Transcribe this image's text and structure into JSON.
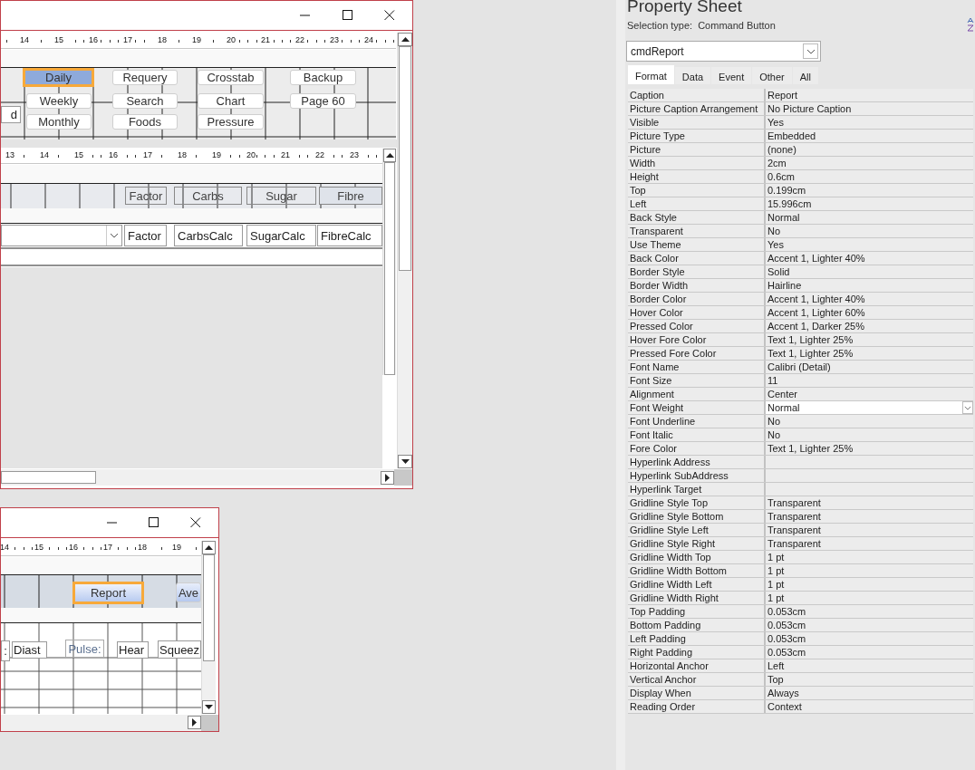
{
  "windows": [
    {
      "ruler": [
        "14",
        "15",
        "16",
        "17",
        "18",
        "19",
        "20",
        "21",
        "22",
        "23",
        "24"
      ],
      "controls": [
        {
          "kind": "textbox",
          "text": "d",
          "selected": false
        },
        {
          "kind": "button",
          "text": "Daily",
          "selected": true
        },
        {
          "kind": "button",
          "text": "Weekly",
          "selected": false
        },
        {
          "kind": "button",
          "text": "Monthly",
          "selected": false
        },
        {
          "kind": "button",
          "text": "Requery",
          "selected": false
        },
        {
          "kind": "button",
          "text": "Search",
          "selected": false
        },
        {
          "kind": "button",
          "text": "Foods",
          "selected": false
        },
        {
          "kind": "button",
          "text": "Crosstab",
          "selected": false
        },
        {
          "kind": "button",
          "text": "Chart",
          "selected": false
        },
        {
          "kind": "button",
          "text": "Pressure",
          "selected": false
        },
        {
          "kind": "button",
          "text": "Backup",
          "selected": false
        },
        {
          "kind": "button",
          "text": "Page 60",
          "selected": false
        }
      ],
      "subform": {
        "ruler": [
          "13",
          "14",
          "15",
          "16",
          "17",
          "18",
          "19",
          "20",
          "21",
          "22",
          "23"
        ],
        "controls": [
          {
            "kind": "label",
            "text": "Factor",
            "selected": false
          },
          {
            "kind": "label",
            "text": "Carbs",
            "selected": false
          },
          {
            "kind": "label",
            "text": "Sugar",
            "selected": false
          },
          {
            "kind": "label",
            "text": "Fibre",
            "selected": false
          },
          {
            "kind": "combo",
            "selected": false
          },
          {
            "kind": "textbox",
            "text": "Factor",
            "selected": false
          },
          {
            "kind": "textbox",
            "text": "CarbsCalc",
            "selected": false
          },
          {
            "kind": "textbox",
            "text": "SugarCalc",
            "selected": false
          },
          {
            "kind": "textbox",
            "text": "FibreCalc",
            "selected": false
          }
        ]
      }
    },
    {
      "ruler": [
        "14",
        "15",
        "16",
        "17",
        "18",
        "19"
      ],
      "controls": [
        {
          "kind": "button",
          "text": "Report",
          "selected": true
        },
        {
          "kind": "button",
          "text": "Ave",
          "selected": false
        },
        {
          "kind": "textbox",
          "text": ":",
          "selected": false
        },
        {
          "kind": "textbox",
          "text": "Diast",
          "selected": false
        },
        {
          "kind": "label",
          "text": "Pulse:",
          "selected": false
        },
        {
          "kind": "textbox",
          "text": "Hear",
          "selected": false
        },
        {
          "kind": "textbox",
          "text": "Squeez",
          "selected": false
        }
      ]
    }
  ],
  "property_sheet": {
    "title": "Property Sheet",
    "selection_type_label": "Selection type:",
    "selection_type": "Command Button",
    "object": "cmdReport",
    "tabs": [
      {
        "label": "Format",
        "selected": true
      },
      {
        "label": "Data",
        "selected": false
      },
      {
        "label": "Event",
        "selected": false
      },
      {
        "label": "Other",
        "selected": false
      },
      {
        "label": "All",
        "selected": false
      }
    ],
    "properties": [
      {
        "name": "Caption",
        "value": "Report",
        "selected": false
      },
      {
        "name": "Picture Caption Arrangement",
        "value": "No Picture Caption",
        "selected": false
      },
      {
        "name": "Visible",
        "value": "Yes",
        "selected": false
      },
      {
        "name": "Picture Type",
        "value": "Embedded",
        "selected": false
      },
      {
        "name": "Picture",
        "value": "(none)",
        "selected": false
      },
      {
        "name": "Width",
        "value": "2cm",
        "selected": false
      },
      {
        "name": "Height",
        "value": "0.6cm",
        "selected": false
      },
      {
        "name": "Top",
        "value": "0.199cm",
        "selected": false
      },
      {
        "name": "Left",
        "value": "15.996cm",
        "selected": false
      },
      {
        "name": "Back Style",
        "value": "Normal",
        "selected": false
      },
      {
        "name": "Transparent",
        "value": "No",
        "selected": false
      },
      {
        "name": "Use Theme",
        "value": "Yes",
        "selected": false
      },
      {
        "name": "Back Color",
        "value": "Accent 1, Lighter 40%",
        "selected": false
      },
      {
        "name": "Border Style",
        "value": "Solid",
        "selected": false
      },
      {
        "name": "Border Width",
        "value": "Hairline",
        "selected": false
      },
      {
        "name": "Border Color",
        "value": "Accent 1, Lighter 40%",
        "selected": false
      },
      {
        "name": "Hover Color",
        "value": "Accent 1, Lighter 60%",
        "selected": false
      },
      {
        "name": "Pressed Color",
        "value": "Accent 1, Darker 25%",
        "selected": false
      },
      {
        "name": "Hover Fore Color",
        "value": "Text 1, Lighter 25%",
        "selected": false
      },
      {
        "name": "Pressed Fore Color",
        "value": "Text 1, Lighter 25%",
        "selected": false
      },
      {
        "name": "Font Name",
        "value": "Calibri (Detail)",
        "selected": false
      },
      {
        "name": "Font Size",
        "value": "11",
        "selected": false
      },
      {
        "name": "Alignment",
        "value": "Center",
        "selected": false
      },
      {
        "name": "Font Weight",
        "value": "Normal",
        "selected": true
      },
      {
        "name": "Font Underline",
        "value": "No",
        "selected": false
      },
      {
        "name": "Font Italic",
        "value": "No",
        "selected": false
      },
      {
        "name": "Fore Color",
        "value": "Text 1, Lighter 25%",
        "selected": false
      },
      {
        "name": "Hyperlink Address",
        "selected": false
      },
      {
        "name": "Hyperlink SubAddress",
        "selected": false
      },
      {
        "name": "Hyperlink Target",
        "selected": false
      },
      {
        "name": "Gridline Style Top",
        "value": "Transparent",
        "selected": false
      },
      {
        "name": "Gridline Style Bottom",
        "value": "Transparent",
        "selected": false
      },
      {
        "name": "Gridline Style Left",
        "value": "Transparent",
        "selected": false
      },
      {
        "name": "Gridline Style Right",
        "value": "Transparent",
        "selected": false
      },
      {
        "name": "Gridline Width Top",
        "value": "1 pt",
        "selected": false
      },
      {
        "name": "Gridline Width Bottom",
        "value": "1 pt",
        "selected": false
      },
      {
        "name": "Gridline Width Left",
        "value": "1 pt",
        "selected": false
      },
      {
        "name": "Gridline Width Right",
        "value": "1 pt",
        "selected": false
      },
      {
        "name": "Top Padding",
        "value": "0.053cm",
        "selected": false
      },
      {
        "name": "Bottom Padding",
        "value": "0.053cm",
        "selected": false
      },
      {
        "name": "Left Padding",
        "value": "0.053cm",
        "selected": false
      },
      {
        "name": "Right Padding",
        "value": "0.053cm",
        "selected": false
      },
      {
        "name": "Horizontal Anchor",
        "value": "Left",
        "selected": false
      },
      {
        "name": "Vertical Anchor",
        "value": "Top",
        "selected": false
      },
      {
        "name": "Display When",
        "value": "Always",
        "selected": false
      },
      {
        "name": "Reading Order",
        "value": "Context",
        "selected": false
      }
    ]
  }
}
